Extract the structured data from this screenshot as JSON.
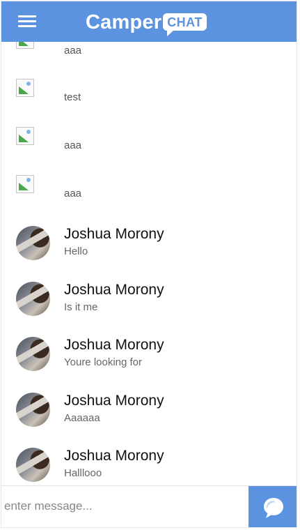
{
  "header": {
    "logo_text": "Camper",
    "logo_badge": "CHAT",
    "menu_icon": "hamburger-menu-icon"
  },
  "image_messages": [
    {
      "text": "aaa"
    },
    {
      "text": "test"
    },
    {
      "text": "aaa"
    },
    {
      "text": "aaa"
    }
  ],
  "chat_messages": [
    {
      "name": "Joshua Morony",
      "message": "Hello"
    },
    {
      "name": "Joshua Morony",
      "message": "Is it me"
    },
    {
      "name": "Joshua Morony",
      "message": "Youre looking for"
    },
    {
      "name": "Joshua Morony",
      "message": "Aaaaaa"
    },
    {
      "name": "Joshua Morony",
      "message": "Halllooo"
    }
  ],
  "composer": {
    "placeholder": "enter message...",
    "value": "",
    "send_icon": "chat-bubble-icon"
  },
  "colors": {
    "brand": "#5b93e0",
    "text_primary": "#111111",
    "text_secondary": "#666666"
  }
}
